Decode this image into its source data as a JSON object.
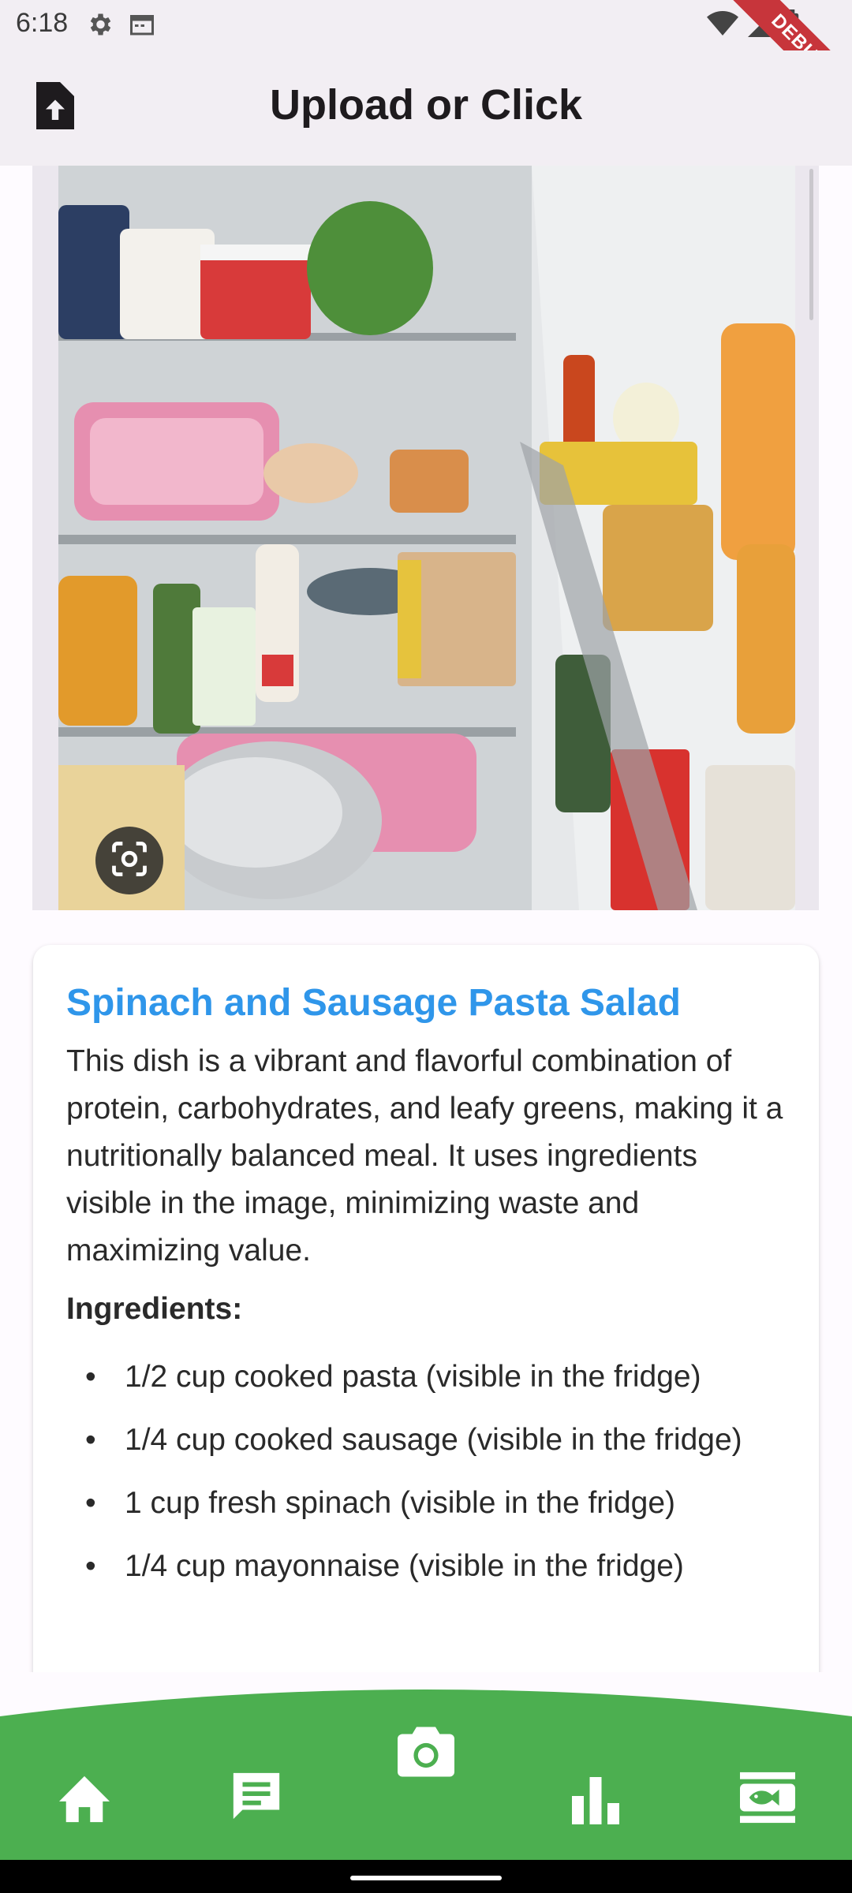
{
  "status_bar": {
    "time": "6:18",
    "debug_label": "DEBUG"
  },
  "app_bar": {
    "title": "Upload or Click"
  },
  "recipe": {
    "title": "Spinach and Sausage Pasta Salad",
    "description": "This dish is a vibrant and flavorful combination of protein, carbohydrates, and leafy greens, making it a nutritionally balanced meal. It uses ingredients visible in the image, minimizing waste and maximizing value.",
    "ingredients_heading": "Ingredients:",
    "ingredients": [
      "1/2 cup cooked pasta (visible in the fridge)",
      "1/4 cup cooked sausage (visible in the fridge)",
      "1 cup fresh spinach (visible in the fridge)",
      "1/4 cup mayonnaise (visible in the fridge)"
    ]
  },
  "bottom_nav": {
    "items": [
      "home-icon",
      "chat-icon",
      "camera-icon",
      "bar-chart-icon",
      "fish-menu-icon"
    ],
    "color": "#4caf50"
  },
  "colors": {
    "accent_title": "#2f96ea",
    "nav_green": "#4caf50",
    "debug_red": "#c7353b"
  }
}
